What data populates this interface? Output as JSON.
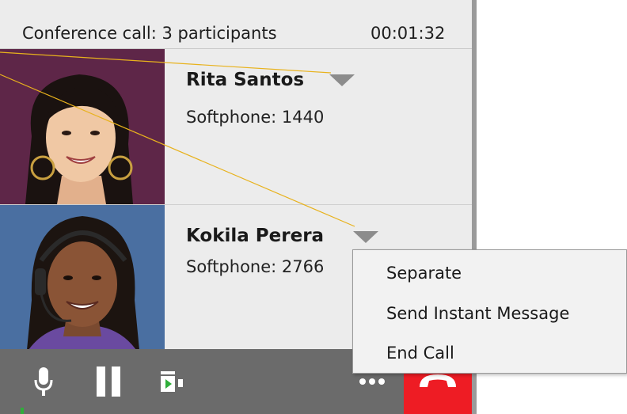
{
  "header": {
    "title": "Conference call: 3 participants",
    "timer": "00:01:32"
  },
  "participants": [
    {
      "name": "Rita Santos",
      "phone": "Softphone: 1440",
      "avatar_bg": "#5e2648"
    },
    {
      "name": "Kokila Perera",
      "phone": "Softphone: 2766",
      "avatar_bg": "#4a6fa1"
    }
  ],
  "toolbar": {
    "icons": [
      "microphone-icon",
      "pause-icon",
      "video-icon",
      "more-icon",
      "end-call-icon"
    ],
    "end_call_color": "#ee1c24",
    "background": "#6b6b6b"
  },
  "context_menu": {
    "items": [
      {
        "label": "Separate"
      },
      {
        "label": "Send Instant Message"
      },
      {
        "label": "End Call"
      }
    ]
  },
  "colors": {
    "callout_line": "#e8b21c",
    "window_bg": "#ececec"
  }
}
